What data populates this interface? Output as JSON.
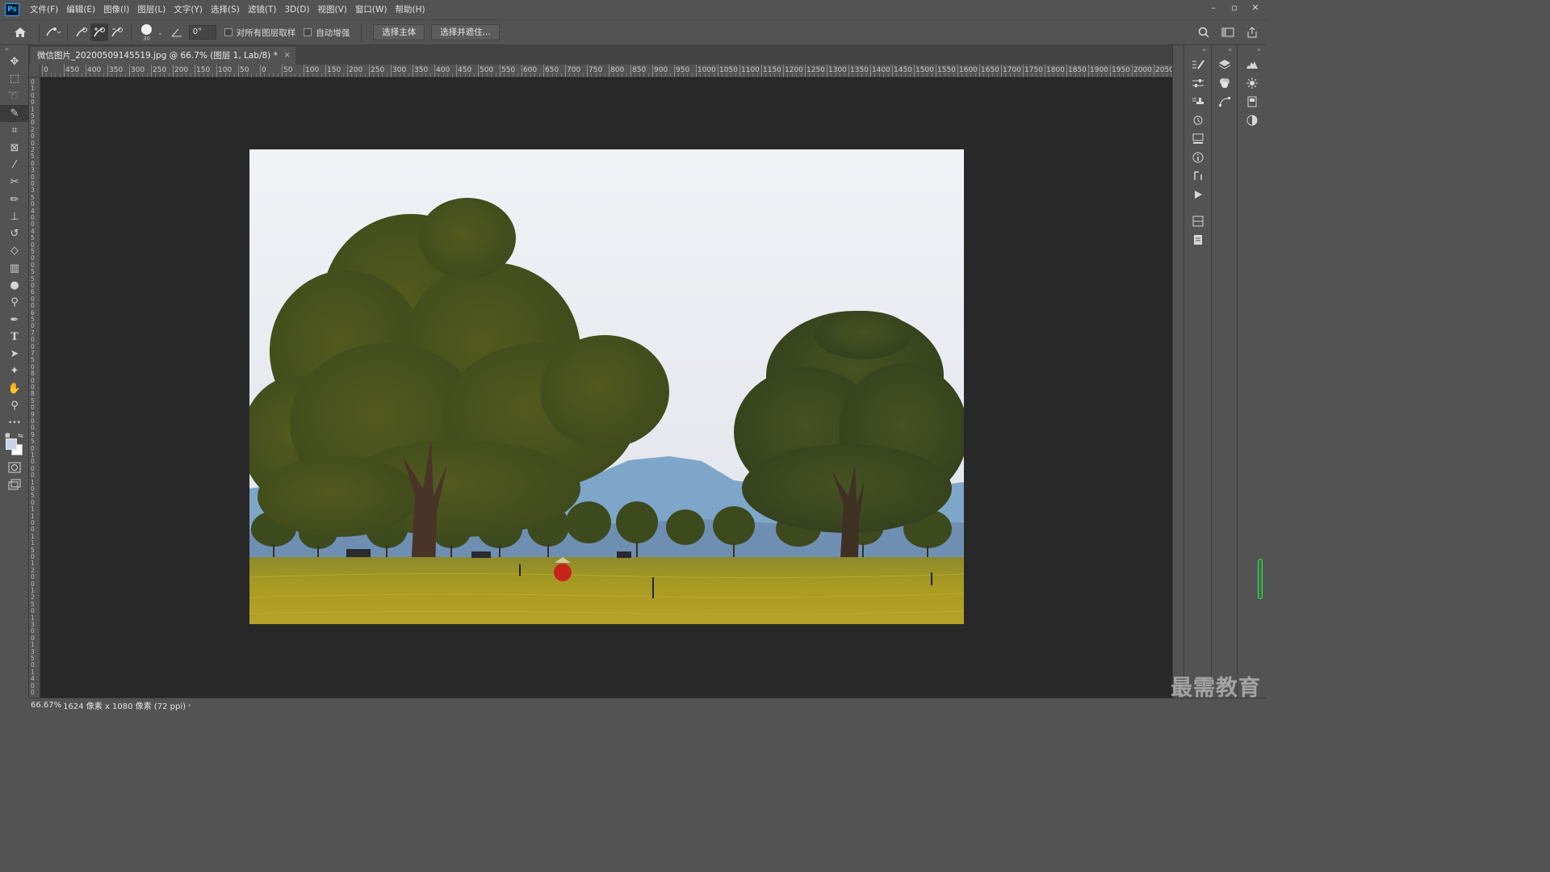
{
  "app": {
    "logo_text": "Ps"
  },
  "menu": [
    "文件(F)",
    "编辑(E)",
    "图像(I)",
    "图层(L)",
    "文字(Y)",
    "选择(S)",
    "滤镜(T)",
    "3D(D)",
    "视图(V)",
    "窗口(W)",
    "帮助(H)"
  ],
  "window_controls": {
    "minimize": "–",
    "restore": "▫",
    "close": "✕"
  },
  "options": {
    "brush_size": "30",
    "angle_value": "0°",
    "sample_all_layers_label": "对所有图层取样",
    "sample_all_layers_checked": false,
    "auto_enhance_label": "自动增强",
    "auto_enhance_checked": false,
    "select_subject_label": "选择主体",
    "select_and_mask_label": "选择并遮住..."
  },
  "document": {
    "tab_title": "微信图片_20200509145519.jpg @ 66.7% (图层 1, Lab/8) *",
    "close_glyph": "×"
  },
  "ruler": {
    "top_labels": [
      "0",
      "450",
      "400",
      "350",
      "300",
      "250",
      "200",
      "150",
      "100",
      "50",
      "0",
      "50",
      "100",
      "150",
      "200",
      "250",
      "300",
      "350",
      "400",
      "450",
      "500",
      "550",
      "600",
      "650",
      "700",
      "750",
      "800",
      "850",
      "900",
      "950",
      "1000",
      "1050",
      "1100",
      "1150",
      "1200",
      "1250",
      "1300",
      "1350",
      "1400",
      "1450",
      "1500",
      "1550",
      "1600",
      "1650",
      "1700",
      "1750",
      "1800",
      "1850",
      "1900",
      "1950",
      "2000",
      "2050"
    ]
  },
  "tools": [
    {
      "name": "move-tool-icon",
      "glyph": "✥",
      "active": false
    },
    {
      "name": "marquee-tool-icon",
      "glyph": "⬚",
      "active": false
    },
    {
      "name": "lasso-tool-icon",
      "glyph": "➰",
      "active": false
    },
    {
      "name": "quick-selection-tool-icon",
      "glyph": "✎",
      "active": true
    },
    {
      "name": "crop-tool-icon",
      "glyph": "⌗",
      "active": false
    },
    {
      "name": "frame-tool-icon",
      "glyph": "⊠",
      "active": false
    },
    {
      "name": "eyedropper-tool-icon",
      "glyph": "⁄",
      "active": false
    },
    {
      "name": "healing-brush-tool-icon",
      "glyph": "✂",
      "active": false
    },
    {
      "name": "brush-tool-icon",
      "glyph": "✏",
      "active": false
    },
    {
      "name": "clone-stamp-tool-icon",
      "glyph": "⊥",
      "active": false
    },
    {
      "name": "history-brush-tool-icon",
      "glyph": "↺",
      "active": false
    },
    {
      "name": "eraser-tool-icon",
      "glyph": "◇",
      "active": false
    },
    {
      "name": "gradient-tool-icon",
      "glyph": "▥",
      "active": false
    },
    {
      "name": "blur-tool-icon",
      "glyph": "●",
      "active": false
    },
    {
      "name": "dodge-tool-icon",
      "glyph": "⚲",
      "active": false
    },
    {
      "name": "pen-tool-icon",
      "glyph": "✒",
      "active": false
    },
    {
      "name": "type-tool-icon",
      "glyph": "T",
      "active": false
    },
    {
      "name": "path-selection-tool-icon",
      "glyph": "➤",
      "active": false
    },
    {
      "name": "shape-tool-icon",
      "glyph": "✦",
      "active": false
    },
    {
      "name": "hand-tool-icon",
      "glyph": "✋",
      "active": false
    },
    {
      "name": "zoom-tool-icon",
      "glyph": "⚲",
      "active": false
    },
    {
      "name": "more-tools-icon",
      "glyph": "•••",
      "active": false
    }
  ],
  "colors": {
    "foreground": "#c7d5e6",
    "background": "#ffffff"
  },
  "status": {
    "zoom": "66.67%",
    "info": "1624 像素 x 1080 像素 (72 ppi)",
    "arrow": "›"
  },
  "watermark": "最需教育"
}
